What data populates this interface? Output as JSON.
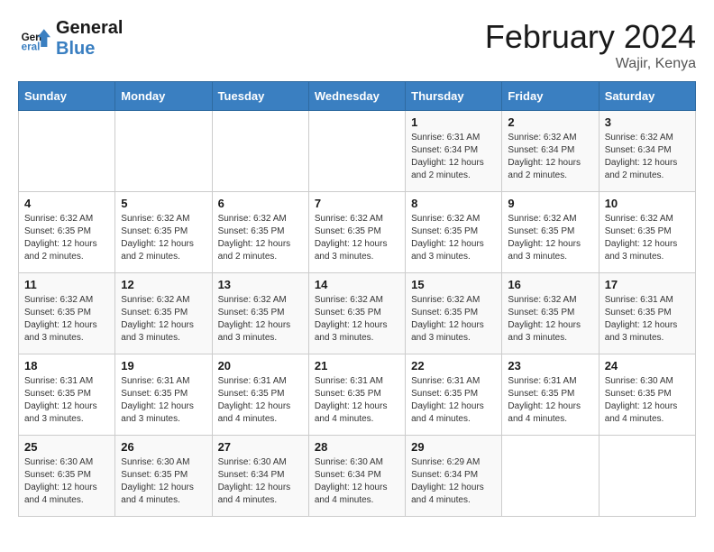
{
  "header": {
    "logo_general": "General",
    "logo_blue": "Blue",
    "month_title": "February 2024",
    "location": "Wajir, Kenya"
  },
  "days_of_week": [
    "Sunday",
    "Monday",
    "Tuesday",
    "Wednesday",
    "Thursday",
    "Friday",
    "Saturday"
  ],
  "weeks": [
    {
      "cells": [
        {
          "day": "",
          "detail": ""
        },
        {
          "day": "",
          "detail": ""
        },
        {
          "day": "",
          "detail": ""
        },
        {
          "day": "",
          "detail": ""
        },
        {
          "day": "1",
          "detail": "Sunrise: 6:31 AM\nSunset: 6:34 PM\nDaylight: 12 hours\nand 2 minutes."
        },
        {
          "day": "2",
          "detail": "Sunrise: 6:32 AM\nSunset: 6:34 PM\nDaylight: 12 hours\nand 2 minutes."
        },
        {
          "day": "3",
          "detail": "Sunrise: 6:32 AM\nSunset: 6:34 PM\nDaylight: 12 hours\nand 2 minutes."
        }
      ]
    },
    {
      "cells": [
        {
          "day": "4",
          "detail": "Sunrise: 6:32 AM\nSunset: 6:35 PM\nDaylight: 12 hours\nand 2 minutes."
        },
        {
          "day": "5",
          "detail": "Sunrise: 6:32 AM\nSunset: 6:35 PM\nDaylight: 12 hours\nand 2 minutes."
        },
        {
          "day": "6",
          "detail": "Sunrise: 6:32 AM\nSunset: 6:35 PM\nDaylight: 12 hours\nand 2 minutes."
        },
        {
          "day": "7",
          "detail": "Sunrise: 6:32 AM\nSunset: 6:35 PM\nDaylight: 12 hours\nand 3 minutes."
        },
        {
          "day": "8",
          "detail": "Sunrise: 6:32 AM\nSunset: 6:35 PM\nDaylight: 12 hours\nand 3 minutes."
        },
        {
          "day": "9",
          "detail": "Sunrise: 6:32 AM\nSunset: 6:35 PM\nDaylight: 12 hours\nand 3 minutes."
        },
        {
          "day": "10",
          "detail": "Sunrise: 6:32 AM\nSunset: 6:35 PM\nDaylight: 12 hours\nand 3 minutes."
        }
      ]
    },
    {
      "cells": [
        {
          "day": "11",
          "detail": "Sunrise: 6:32 AM\nSunset: 6:35 PM\nDaylight: 12 hours\nand 3 minutes."
        },
        {
          "day": "12",
          "detail": "Sunrise: 6:32 AM\nSunset: 6:35 PM\nDaylight: 12 hours\nand 3 minutes."
        },
        {
          "day": "13",
          "detail": "Sunrise: 6:32 AM\nSunset: 6:35 PM\nDaylight: 12 hours\nand 3 minutes."
        },
        {
          "day": "14",
          "detail": "Sunrise: 6:32 AM\nSunset: 6:35 PM\nDaylight: 12 hours\nand 3 minutes."
        },
        {
          "day": "15",
          "detail": "Sunrise: 6:32 AM\nSunset: 6:35 PM\nDaylight: 12 hours\nand 3 minutes."
        },
        {
          "day": "16",
          "detail": "Sunrise: 6:32 AM\nSunset: 6:35 PM\nDaylight: 12 hours\nand 3 minutes."
        },
        {
          "day": "17",
          "detail": "Sunrise: 6:31 AM\nSunset: 6:35 PM\nDaylight: 12 hours\nand 3 minutes."
        }
      ]
    },
    {
      "cells": [
        {
          "day": "18",
          "detail": "Sunrise: 6:31 AM\nSunset: 6:35 PM\nDaylight: 12 hours\nand 3 minutes."
        },
        {
          "day": "19",
          "detail": "Sunrise: 6:31 AM\nSunset: 6:35 PM\nDaylight: 12 hours\nand 3 minutes."
        },
        {
          "day": "20",
          "detail": "Sunrise: 6:31 AM\nSunset: 6:35 PM\nDaylight: 12 hours\nand 4 minutes."
        },
        {
          "day": "21",
          "detail": "Sunrise: 6:31 AM\nSunset: 6:35 PM\nDaylight: 12 hours\nand 4 minutes."
        },
        {
          "day": "22",
          "detail": "Sunrise: 6:31 AM\nSunset: 6:35 PM\nDaylight: 12 hours\nand 4 minutes."
        },
        {
          "day": "23",
          "detail": "Sunrise: 6:31 AM\nSunset: 6:35 PM\nDaylight: 12 hours\nand 4 minutes."
        },
        {
          "day": "24",
          "detail": "Sunrise: 6:30 AM\nSunset: 6:35 PM\nDaylight: 12 hours\nand 4 minutes."
        }
      ]
    },
    {
      "cells": [
        {
          "day": "25",
          "detail": "Sunrise: 6:30 AM\nSunset: 6:35 PM\nDaylight: 12 hours\nand 4 minutes."
        },
        {
          "day": "26",
          "detail": "Sunrise: 6:30 AM\nSunset: 6:35 PM\nDaylight: 12 hours\nand 4 minutes."
        },
        {
          "day": "27",
          "detail": "Sunrise: 6:30 AM\nSunset: 6:34 PM\nDaylight: 12 hours\nand 4 minutes."
        },
        {
          "day": "28",
          "detail": "Sunrise: 6:30 AM\nSunset: 6:34 PM\nDaylight: 12 hours\nand 4 minutes."
        },
        {
          "day": "29",
          "detail": "Sunrise: 6:29 AM\nSunset: 6:34 PM\nDaylight: 12 hours\nand 4 minutes."
        },
        {
          "day": "",
          "detail": ""
        },
        {
          "day": "",
          "detail": ""
        }
      ]
    }
  ]
}
